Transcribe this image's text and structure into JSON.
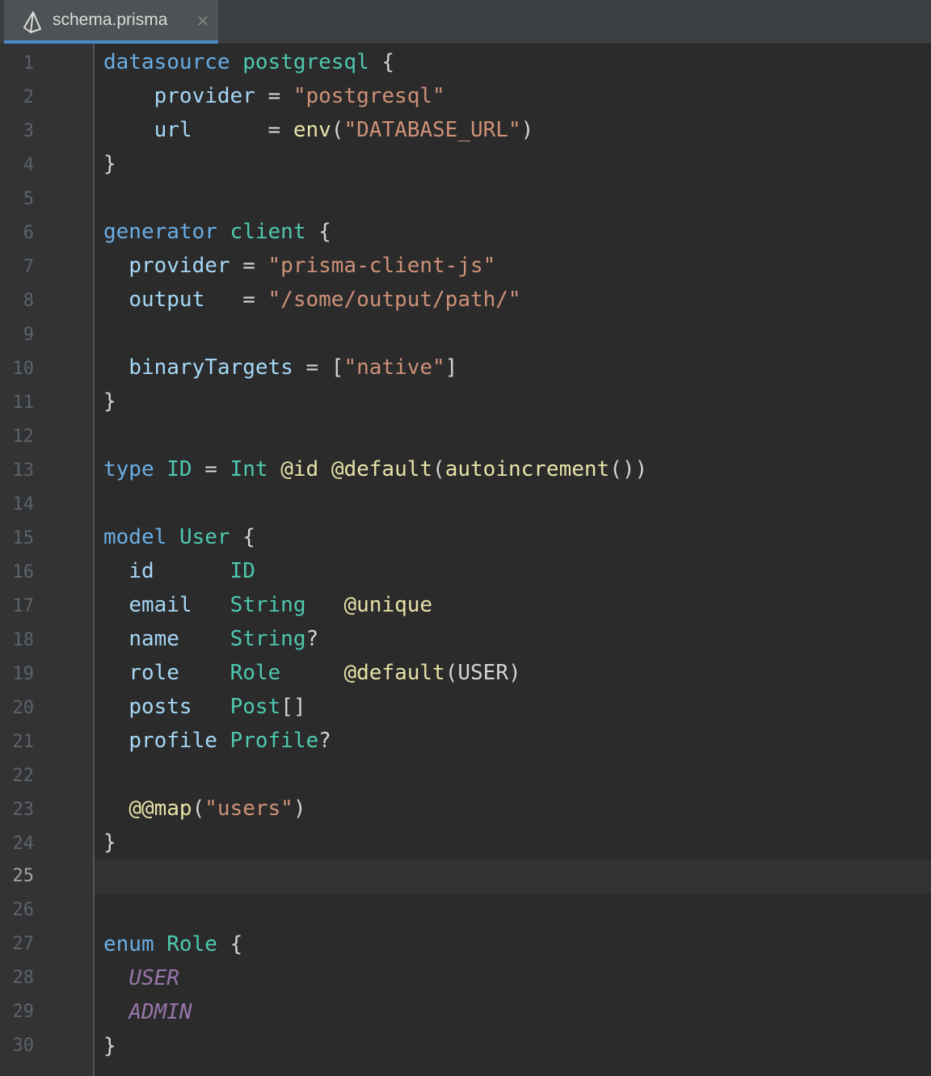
{
  "tab": {
    "filename": "schema.prisma",
    "close_symbol": "✕",
    "icon": "prisma-icon"
  },
  "editor": {
    "current_line": 25,
    "line_numbers": [
      "1",
      "2",
      "3",
      "4",
      "5",
      "6",
      "7",
      "8",
      "9",
      "10",
      "11",
      "12",
      "13",
      "14",
      "15",
      "16",
      "17",
      "18",
      "19",
      "20",
      "21",
      "22",
      "23",
      "24",
      "25",
      "26",
      "27",
      "28",
      "29",
      "30"
    ],
    "lines": {
      "l1": {
        "kw": "datasource",
        "name": "postgresql",
        "brace": "{"
      },
      "l2": {
        "key": "provider",
        "eq": "=",
        "value": "\"postgresql\""
      },
      "l3": {
        "key": "url",
        "eq": "=",
        "fn": "env",
        "open": "(",
        "value": "\"DATABASE_URL\"",
        "close": ")"
      },
      "l4": {
        "brace": "}"
      },
      "l6": {
        "kw": "generator",
        "name": "client",
        "brace": "{"
      },
      "l7": {
        "key": "provider",
        "eq": "=",
        "value": "\"prisma-client-js\""
      },
      "l8": {
        "key": "output",
        "eq": "=",
        "value": "\"/some/output/path/\""
      },
      "l10": {
        "key": "binaryTargets",
        "eq": "=",
        "open": "[",
        "value": "\"native\"",
        "close": "]"
      },
      "l11": {
        "brace": "}"
      },
      "l13": {
        "kw": "type",
        "name": "ID",
        "eq": "=",
        "type": "Int",
        "attr1": "@id",
        "attr2": "@default",
        "open": "(",
        "fn": "autoincrement",
        "call": "()",
        "close": ")"
      },
      "l15": {
        "kw": "model",
        "name": "User",
        "brace": "{"
      },
      "l16": {
        "field": "id",
        "type": "ID"
      },
      "l17": {
        "field": "email",
        "type": "String",
        "attr": "@unique"
      },
      "l18": {
        "field": "name",
        "type": "String",
        "mod": "?"
      },
      "l19": {
        "field": "role",
        "type": "Role",
        "attr": "@default",
        "open": "(",
        "arg": "USER",
        "close": ")"
      },
      "l20": {
        "field": "posts",
        "type": "Post",
        "mod": "[]"
      },
      "l21": {
        "field": "profile",
        "type": "Profile",
        "mod": "?"
      },
      "l23": {
        "attr": "@@map",
        "open": "(",
        "value": "\"users\"",
        "close": ")"
      },
      "l24": {
        "brace": "}"
      },
      "l27": {
        "kw": "enum",
        "name": "Role",
        "brace": "{"
      },
      "l28": {
        "value": "USER"
      },
      "l29": {
        "value": "ADMIN"
      },
      "l30": {
        "brace": "}"
      }
    }
  },
  "colors": {
    "background": "#2b2b2b",
    "gutter": "#313335",
    "keyword": "#6aaee5",
    "type_name": "#4ec9b0",
    "field": "#a6d8f6",
    "string": "#ce9178",
    "attribute": "#e8e3a8",
    "enum_value": "#9876aa",
    "tab_accent": "#4a88c7"
  }
}
